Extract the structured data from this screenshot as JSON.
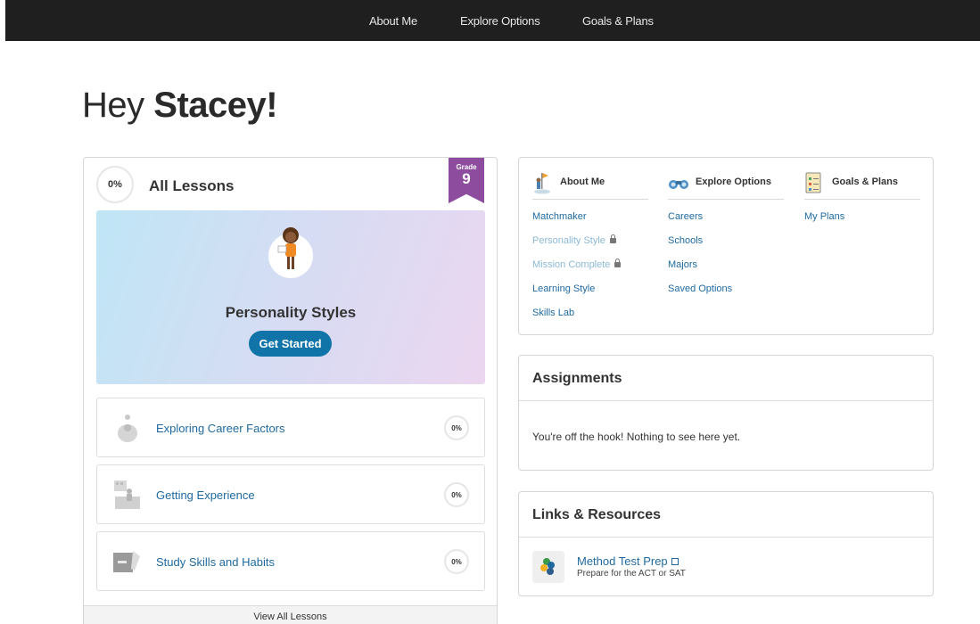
{
  "topnav": {
    "items": [
      "About Me",
      "Explore Options",
      "Goals & Plans"
    ]
  },
  "greeting": {
    "prefix": "Hey",
    "name": "Stacey!"
  },
  "lessons": {
    "progress": "0%",
    "title": "All Lessons",
    "grade_label": "Grade",
    "grade_value": "9",
    "featured": {
      "title": "Personality Styles",
      "button": "Get Started"
    },
    "rows": [
      {
        "label": "Exploring Career Factors",
        "progress": "0%"
      },
      {
        "label": "Getting Experience",
        "progress": "0%"
      },
      {
        "label": "Study Skills and Habits",
        "progress": "0%"
      }
    ],
    "view_all": "View All Lessons"
  },
  "quicknav": {
    "columns": [
      {
        "heading": "About Me",
        "icon": "person-flag-icon",
        "links": [
          {
            "label": "Matchmaker",
            "locked": false
          },
          {
            "label": "Personality Style",
            "locked": true
          },
          {
            "label": "Mission Complete",
            "locked": true
          },
          {
            "label": "Learning Style",
            "locked": false
          },
          {
            "label": "Skills Lab",
            "locked": false
          }
        ]
      },
      {
        "heading": "Explore Options",
        "icon": "binoculars-icon",
        "links": [
          {
            "label": "Careers",
            "locked": false
          },
          {
            "label": "Schools",
            "locked": false
          },
          {
            "label": "Majors",
            "locked": false
          },
          {
            "label": "Saved Options",
            "locked": false
          }
        ]
      },
      {
        "heading": "Goals & Plans",
        "icon": "checklist-icon",
        "links": [
          {
            "label": "My Plans",
            "locked": false
          }
        ]
      }
    ]
  },
  "assignments": {
    "title": "Assignments",
    "message": "You're off the hook! Nothing to see here yet."
  },
  "resources": {
    "title": "Links & Resources",
    "items": [
      {
        "title": "Method Test Prep",
        "subtitle": "Prepare for the ACT or SAT"
      }
    ]
  },
  "colors": {
    "nav_bg": "#1f1f1f",
    "link": "#1e6aa0",
    "button": "#1074a9",
    "grade_ribbon": "#8d4c9e"
  }
}
